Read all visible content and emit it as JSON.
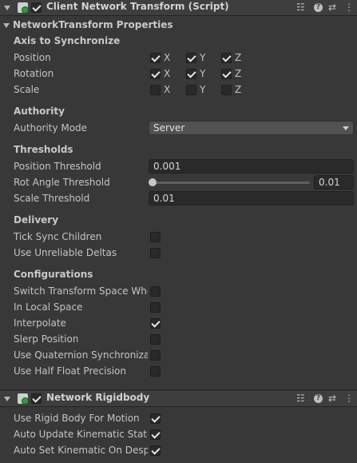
{
  "component1": {
    "title": "Client Network Transform (Script)",
    "enabled": true,
    "properties_header": "NetworkTransform Properties",
    "axis": {
      "header": "Axis to Synchronize",
      "rows": [
        {
          "label": "Position",
          "x": true,
          "y": true,
          "z": true
        },
        {
          "label": "Rotation",
          "x": true,
          "y": true,
          "z": true
        },
        {
          "label": "Scale",
          "x": false,
          "y": false,
          "z": false
        }
      ],
      "x_label": "X",
      "y_label": "Y",
      "z_label": "Z"
    },
    "authority": {
      "header": "Authority",
      "mode_label": "Authority Mode",
      "mode_value": "Server"
    },
    "thresholds": {
      "header": "Thresholds",
      "position_label": "Position Threshold",
      "position_value": "0.001",
      "rot_label": "Rot Angle Threshold",
      "rot_value": "0.01",
      "rot_slider_fraction": 0.0,
      "scale_label": "Scale Threshold",
      "scale_value": "0.01"
    },
    "delivery": {
      "header": "Delivery",
      "tick_sync_label": "Tick Sync Children",
      "tick_sync": false,
      "unreliable_label": "Use Unreliable Deltas",
      "unreliable": false
    },
    "configurations": {
      "header": "Configurations",
      "items": [
        {
          "label": "Switch Transform Space Whe",
          "checked": false
        },
        {
          "label": "In Local Space",
          "checked": false
        },
        {
          "label": "Interpolate",
          "checked": true
        },
        {
          "label": "Slerp Position",
          "checked": false
        },
        {
          "label": "Use Quaternion Synchronizati",
          "checked": false
        },
        {
          "label": "Use Half Float Precision",
          "checked": false
        }
      ]
    }
  },
  "component2": {
    "title": "Network Rigidbody",
    "enabled": true,
    "items": [
      {
        "label": "Use Rigid Body For Motion",
        "checked": true
      },
      {
        "label": "Auto Update Kinematic State",
        "checked": true
      },
      {
        "label": "Auto Set Kinematic On Despa",
        "checked": true
      }
    ]
  },
  "icons": {
    "header_icons": [
      "preset-icon",
      "help-icon",
      "settings-sliders-icon",
      "more-menu-icon"
    ]
  }
}
